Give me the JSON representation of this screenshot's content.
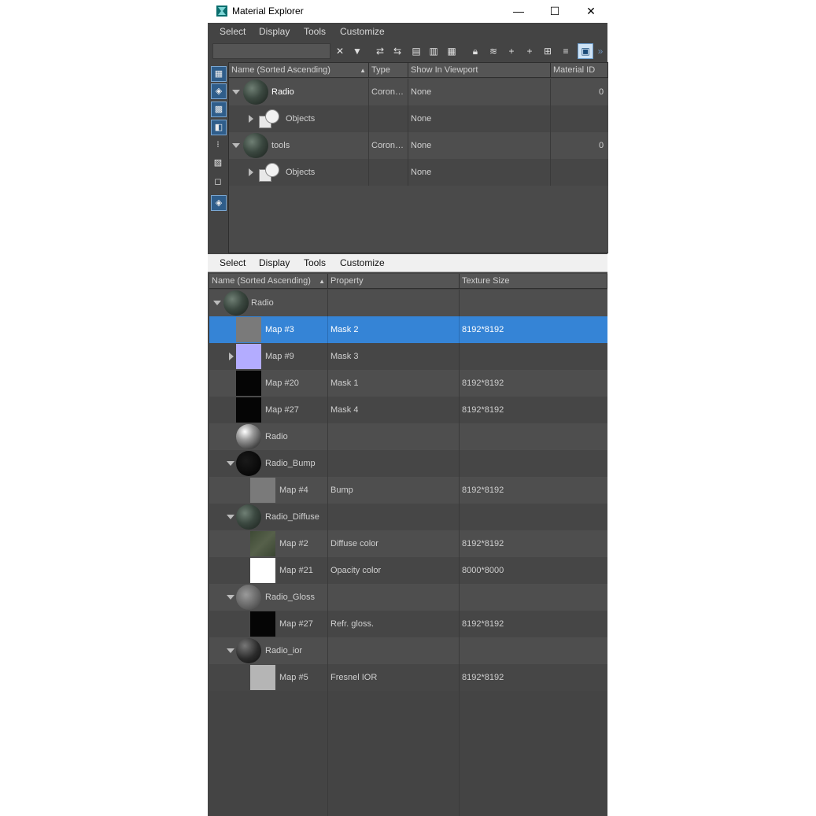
{
  "window": {
    "title": "Material Explorer",
    "minimize": "—",
    "maximize": "☐",
    "close": "✕"
  },
  "upper_menu": [
    "Select",
    "Display",
    "Tools",
    "Customize"
  ],
  "lower_menu": [
    "Select",
    "Display",
    "Tools",
    "Customize"
  ],
  "upper_table": {
    "headers": [
      "Name (Sorted Ascending)",
      "Type",
      "Show In Viewport",
      "Material ID"
    ],
    "rows": [
      {
        "name": "Radio",
        "type": "Coron…",
        "viewport": "None",
        "id": "0"
      },
      {
        "name": "Objects",
        "type": "",
        "viewport": "None",
        "id": ""
      },
      {
        "name": "tools",
        "type": "Coron…",
        "viewport": "None",
        "id": "0"
      },
      {
        "name": "Objects",
        "type": "",
        "viewport": "None",
        "id": ""
      }
    ]
  },
  "lower_table": {
    "headers": [
      "Name (Sorted Ascending)",
      "Property",
      "Texture Size"
    ],
    "rows": [
      {
        "name": "Radio",
        "property": "",
        "size": ""
      },
      {
        "name": "Map #3",
        "property": "Mask 2",
        "size": "8192*8192"
      },
      {
        "name": "Map #9",
        "property": "Mask 3",
        "size": ""
      },
      {
        "name": "Map #20",
        "property": "Mask 1",
        "size": "8192*8192"
      },
      {
        "name": "Map #27",
        "property": "Mask 4",
        "size": "8192*8192"
      },
      {
        "name": "Radio",
        "property": "",
        "size": ""
      },
      {
        "name": "Radio_Bump",
        "property": "",
        "size": ""
      },
      {
        "name": "Map #4",
        "property": "Bump",
        "size": "8192*8192"
      },
      {
        "name": "Radio_Diffuse",
        "property": "",
        "size": ""
      },
      {
        "name": "Map #2",
        "property": "Diffuse color",
        "size": "8192*8192"
      },
      {
        "name": "Map #21",
        "property": "Opacity color",
        "size": "8000*8000"
      },
      {
        "name": "Radio_Gloss",
        "property": "",
        "size": ""
      },
      {
        "name": "Map #27",
        "property": "Refr. gloss.",
        "size": "8192*8192"
      },
      {
        "name": "Radio_ior",
        "property": "",
        "size": ""
      },
      {
        "name": "Map #5",
        "property": "Fresnel IOR",
        "size": "8192*8192"
      }
    ]
  },
  "selected_row_color": "#3584d6"
}
